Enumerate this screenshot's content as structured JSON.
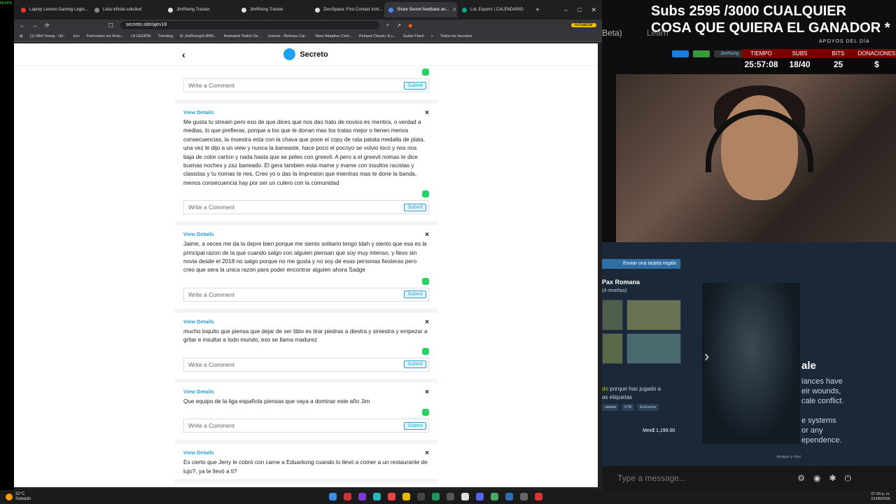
{
  "browser": {
    "tabs": [
      {
        "label": "Laptop Lenovo Gaming Legio...",
        "active": false
      },
      {
        "label": "Lista infinita solicitud",
        "active": false
      },
      {
        "label": "JimRising Tracker",
        "active": false
      },
      {
        "label": "JimRising Tracker",
        "active": false
      },
      {
        "label": "ZeroSpace: First Contact Invit...",
        "active": false
      },
      {
        "label": "Share Secret feedback an...",
        "active": true
      },
      {
        "label": "LoL Esports | CALENDARIO",
        "active": false
      }
    ],
    "new_tab": "+",
    "window_controls": [
      "–",
      "□",
      "✕"
    ],
    "address": "secreto.site/ajev18",
    "update_label": "Actualizar",
    "bookmarks": [
      "(1) Nihil Young - Ult...",
      "tryn",
      "Formulario sin título...",
      "LA LEGION",
      "Trending",
      "IE JimRising#LANN...",
      "Animated Twitch Ov...",
      "Games - Release Cal...",
      "Xbox Adaptive Cont...",
      "Petopia Classic: A c...",
      "Guitar Flash",
      "»",
      "Todos los favoritos"
    ]
  },
  "site": {
    "title": "Secreto",
    "back": "‹",
    "comment_placeholder": "Write a Comment",
    "submit_label": "Submit",
    "view_details": "View Details",
    "close": "×",
    "posts": [
      "Me gusta tu stream pero eso de que dices que nos das trato de novios es mentira, o verdad a medias, lo que prefieras, porque a los que te donan mas los tratas mejor o tienen menos consecuencias, la muestra esta con la chava que pone el copy de rata patata medalla de plata, una vez le dijo a un view y nunca la baneaste, hace poco el pocoyo se volvio loco y nos nos baja de color carton y nada hasta que se peleo con greevil. A pero a el greevil nomas te dice buenas noches y zaz baneado. El gera tambien esta mame y mame con insultos racistas y clasistas y tu nomas te ries. Creo yo o das la impresion que mientras mas te done la banda, menos consecuencia hay por ser un culero con la comunidad",
      "Jaime, a veces me da la depre bien porque me siento solitario tengo tdah y siento que esa es la principal razon de la que cuando salgo con alguien piensan que soy muy intenso, y llevo sin novia desde el 2018 no salgo porque no me gusta y no soy de esas personas fiesteras pero creo que sera la unica razon para poder encontrar alguien ahora Sadge",
      "mucho loquito que piensa que dejar de ser tibio es tirar piedras a diestra y siniestra y empezar a gritar e insultar a todo mundo, eso se llama madurez",
      "Que equipo de la liga española piensas que vaya a dominar este año Jim",
      "Es cierto que Jerry le cobró con carne a Eduarkong cuando lo llevó a comer a un restaurante de lujo?, ya te llevó a ti?"
    ]
  },
  "stream": {
    "banner_line1": "Subs 2595 /3000 CUALQUIER",
    "banner_line2": "COSA QUE QUIERA EL GANADOR *",
    "apoyos": "APOYOS DEL DÍA",
    "channel_tag": "JimRising",
    "stats": [
      {
        "key": "TIEMPO",
        "value": "25:57:08"
      },
      {
        "key": "SUBS",
        "value": "18/40"
      },
      {
        "key": "BITS",
        "value": "25"
      },
      {
        "key": "DONACIONES",
        "value": "$"
      }
    ],
    "store": {
      "gift": "Enviar una tarjeta regalo",
      "game": "Pax Romana",
      "reviews": "(4 reseñas)",
      "why_highlight": "do",
      "why_rest": " porque has jugado a",
      "why_line2": "as etiquetas",
      "tags": [
        "udades",
        "ETR",
        "Economía"
      ],
      "price": "Mex$ 1,199.00",
      "big_title": "ale",
      "big_lines": [
        "iances have",
        "eir wounds,",
        "cale conflict.",
        "",
        "e systems",
        "or any",
        "ependence."
      ],
      "amigos": "Amigos y chat"
    },
    "chat_placeholder": "Type a message...",
    "side_labels": [
      "Beta)",
      "Learn"
    ]
  },
  "taskbar": {
    "weather_temp": "32°C",
    "weather_desc": "Soleado",
    "time": "07:39 p. m.",
    "date": "01/08/2026",
    "fps": "49 FPS"
  },
  "colors": {
    "accent": "#2a9fd6",
    "whatsapp": "#25d366",
    "steam_bg": "#1b2838"
  }
}
